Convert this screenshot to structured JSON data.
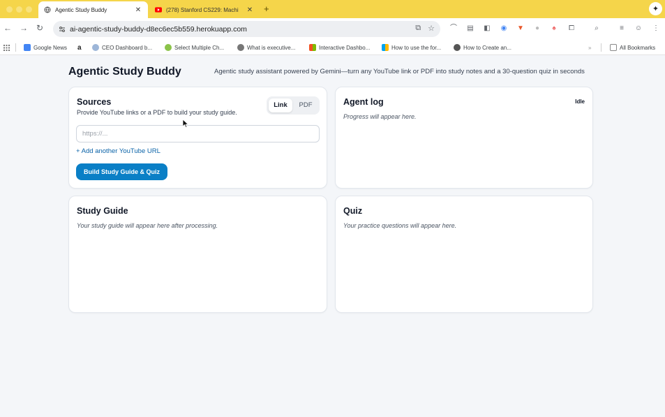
{
  "browser": {
    "tabs": [
      {
        "title": "Agentic Study Buddy",
        "active": true
      },
      {
        "title": "(278) Stanford CS229: Machi",
        "active": false
      }
    ],
    "url": "ai-agentic-study-buddy-d8ec6ec5b559.herokuapp.com",
    "bookmarks": [
      {
        "label": "Google News",
        "color": "#4285f4"
      },
      {
        "label": "",
        "color": "#222222",
        "icon": "amazon-icon"
      },
      {
        "label": "CEO Dashboard b...",
        "color": "#9db6d8"
      },
      {
        "label": "Select Multiple Ch...",
        "color": "#8bc34a"
      },
      {
        "label": "What is executive...",
        "color": "#777777"
      },
      {
        "label": "Interactive Dashbo...",
        "color": "#f25022"
      },
      {
        "label": "How to use the for...",
        "color": "#7fba00"
      },
      {
        "label": "How to Create an...",
        "color": "#555555"
      }
    ],
    "all_bookmarks_label": "All Bookmarks"
  },
  "app": {
    "title": "Agentic Study Buddy",
    "subtitle": "Agentic study assistant powered by Gemini—turn any YouTube link or PDF into study notes and a 30-question quiz in seconds"
  },
  "sources": {
    "title": "Sources",
    "description": "Provide YouTube links or a PDF to build your study guide.",
    "toggle": {
      "link_label": "Link",
      "pdf_label": "PDF",
      "selected": "Link"
    },
    "url_input": {
      "placeholder": "https://...",
      "value": ""
    },
    "add_link_label": "+ Add another YouTube URL",
    "build_button_label": "Build Study Guide & Quiz"
  },
  "agent_log": {
    "title": "Agent log",
    "status": "Idle",
    "placeholder": "Progress will appear here."
  },
  "study_guide": {
    "title": "Study Guide",
    "placeholder": "Your study guide will appear here after processing."
  },
  "quiz": {
    "title": "Quiz",
    "placeholder": "Your practice questions will appear here."
  },
  "colors": {
    "tabbar": "#f5d54a",
    "primary_button": "#0a7fc6",
    "link": "#0b63a8",
    "page_background": "#f4f6f9"
  }
}
